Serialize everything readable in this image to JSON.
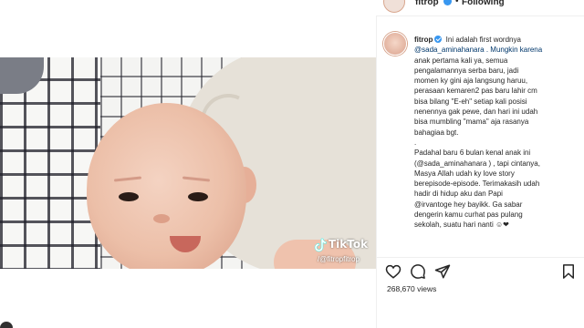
{
  "header": {
    "username": "fitrop",
    "separator": "•",
    "follow_status": "Following"
  },
  "media": {
    "tiktok_label": "TikTok",
    "tiktok_handle": "/@fitropfitrop"
  },
  "caption": {
    "username": "fitrop",
    "lines": [
      " Ini adalah first wordnya",
      "@sada_aminahanara . Mungkin karena",
      "anak pertama kali ya, semua",
      "pengalamannya serba baru, jadi",
      "momen ky gini aja langsung haruu,",
      "perasaan kemaren2 pas baru lahir cm",
      "bisa bilang \"E-eh\" setiap kali posisi",
      "nenennya gak pewe, dan hari ini udah",
      "bisa mumbling \"mama\" aja rasanya",
      "bahagiaa bgt.",
      ".",
      "Padahal baru 6 bulan kenal anak ini",
      "(@sada_aminahanara ) , tapi cintanya,",
      "Masya Allah udah ky love story",
      "berepisode-episode. Terimakasih udah",
      "hadir di hidup aku dan Papi",
      "@irvantoge hey bayikk. Ga sabar",
      "dengerin kamu curhat pas pulang",
      "sekolah, suatu hari nanti ☺❤"
    ]
  },
  "stats": {
    "views": "268,670 views"
  },
  "icons": {
    "like": "heart-icon",
    "comment": "comment-icon",
    "share": "share-icon",
    "save": "bookmark-icon",
    "verified": "verified-badge-icon"
  },
  "colors": {
    "verified": "#3897f0",
    "text": "#262626",
    "mention": "#00376b"
  }
}
